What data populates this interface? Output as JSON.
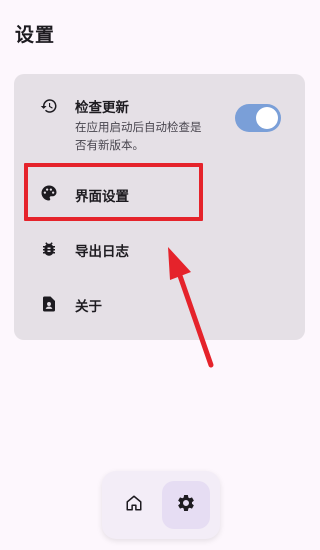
{
  "header": {
    "title": "设置"
  },
  "settings": {
    "items": [
      {
        "icon": "update-history-icon",
        "label": "检查更新",
        "desc_line1": "在应用启动后自动检查是",
        "desc_line2": "否有新版本。",
        "toggle_on": true
      },
      {
        "icon": "palette-icon",
        "label": "界面设置"
      },
      {
        "icon": "bug-icon",
        "label": "导出日志"
      },
      {
        "icon": "info-icon",
        "label": "关于"
      }
    ]
  },
  "nav": {
    "items": [
      {
        "icon": "home-icon",
        "selected": false
      },
      {
        "icon": "gear-icon",
        "selected": true
      }
    ]
  },
  "colors": {
    "background": "#FDF7FD",
    "card": "#E5E0E6",
    "toggle_track": "#7A9FD8",
    "annotation_red": "#E5232B",
    "nav_selected": "#E6DDF3"
  }
}
